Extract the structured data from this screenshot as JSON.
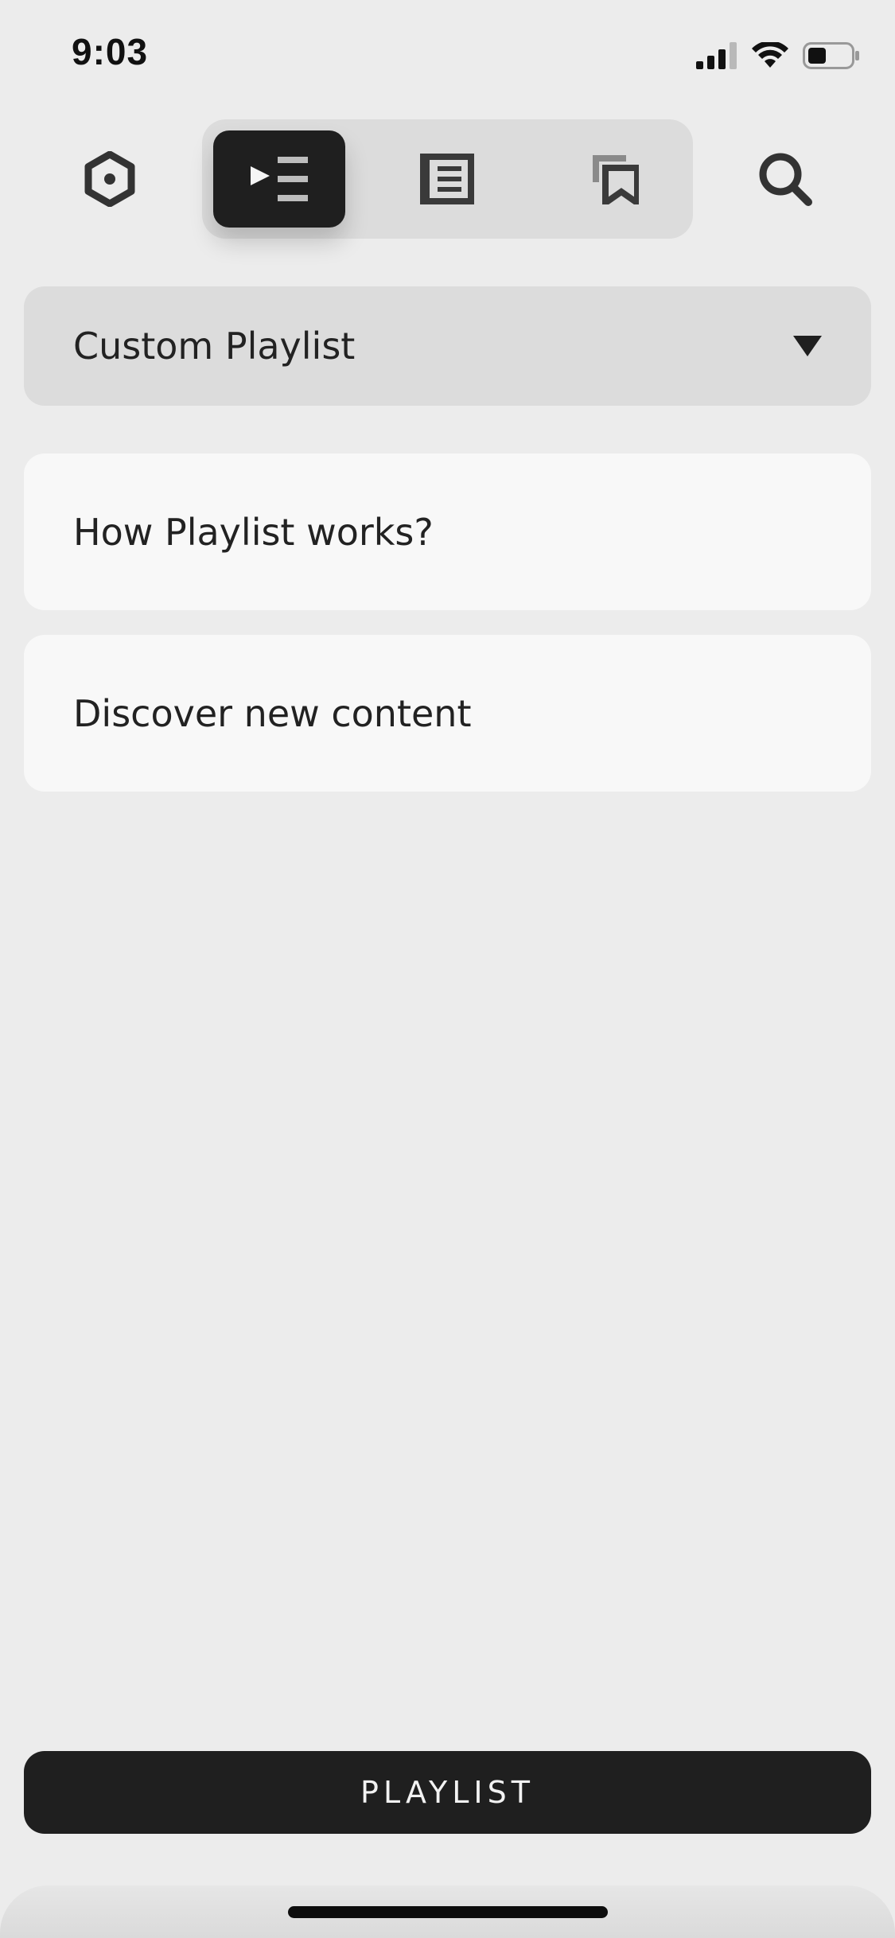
{
  "status_bar": {
    "time": "9:03",
    "icons": [
      "cellular-signal-icon",
      "wifi-icon",
      "battery-icon"
    ]
  },
  "top_bar": {
    "left_icon": "settings-hexagon-icon",
    "right_icon": "search-icon",
    "tabs": [
      {
        "icon": "playlist-icon",
        "active": true
      },
      {
        "icon": "articles-icon",
        "active": false
      },
      {
        "icon": "bookmarks-icon",
        "active": false
      }
    ]
  },
  "dropdown": {
    "selected": "Custom Playlist"
  },
  "cards": [
    {
      "label": "How Playlist works?"
    },
    {
      "label": "Discover new content"
    }
  ],
  "bottom_button": {
    "label": "PLAYLIST"
  },
  "colors": {
    "background": "#ececec",
    "surface": "#dcdcdc",
    "card": "#f8f8f8",
    "dark": "#1f1f1f"
  }
}
